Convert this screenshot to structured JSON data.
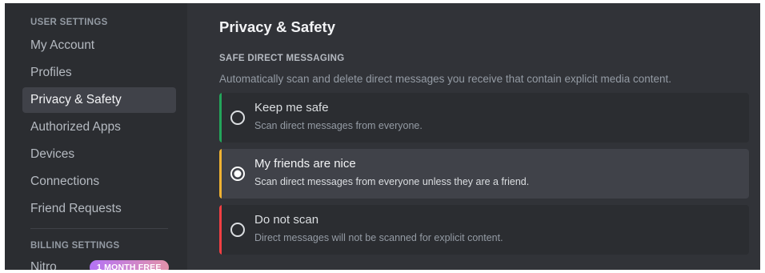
{
  "sidebar": {
    "user_settings_header": "USER SETTINGS",
    "items": [
      {
        "label": "My Account"
      },
      {
        "label": "Profiles"
      },
      {
        "label": "Privacy & Safety",
        "active": true
      },
      {
        "label": "Authorized Apps"
      },
      {
        "label": "Devices"
      },
      {
        "label": "Connections"
      },
      {
        "label": "Friend Requests"
      }
    ],
    "billing_settings_header": "BILLING SETTINGS",
    "nitro": {
      "label": "Nitro",
      "badge": "1 MONTH FREE"
    }
  },
  "main": {
    "title": "Privacy & Safety",
    "section": {
      "title": "SAFE DIRECT MESSAGING",
      "description": "Automatically scan and delete direct messages you receive that contain explicit media content.",
      "options": [
        {
          "label": "Keep me safe",
          "description": "Scan direct messages from everyone.",
          "accent": "#23a55a",
          "selected": false
        },
        {
          "label": "My friends are nice",
          "description": "Scan direct messages from everyone unless they are a friend.",
          "accent": "#f0b232",
          "selected": true
        },
        {
          "label": "Do not scan",
          "description": "Direct messages will not be scanned for explicit content.",
          "accent": "#f23f43",
          "selected": false
        }
      ]
    }
  },
  "colors": {
    "sidebar_bg": "#2b2d31",
    "main_bg": "#313338",
    "selected_bg": "#404249"
  },
  "icons": {
    "radio_empty": "radio-empty-icon",
    "radio_selected": "radio-selected-icon"
  }
}
